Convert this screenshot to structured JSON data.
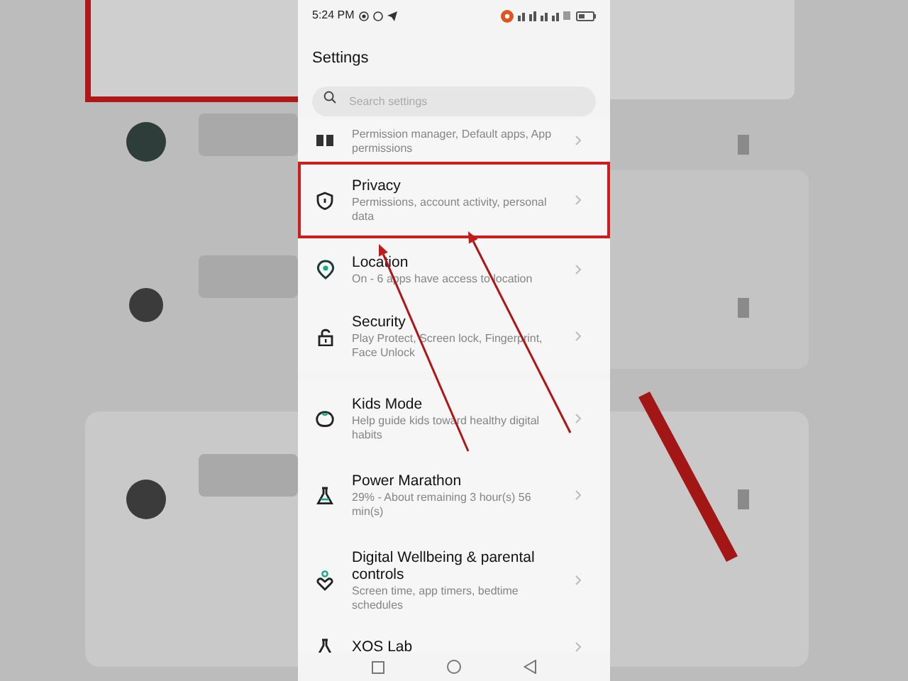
{
  "status_bar": {
    "time": "5:24 PM"
  },
  "title": "Settings",
  "search": {
    "placeholder": "Search settings"
  },
  "items": [
    {
      "kind": "apps",
      "subtitle": "Permission manager, Default apps, App permissions",
      "highlighted": false
    },
    {
      "kind": "privacy",
      "title": "Privacy",
      "subtitle": "Permissions, account activity, personal data",
      "highlighted": true
    },
    {
      "kind": "location",
      "title": "Location",
      "subtitle": "On - 6 apps have access to location",
      "highlighted": false
    },
    {
      "kind": "security",
      "title": "Security",
      "subtitle": "Play Protect, Screen lock, Fingerprint, Face Unlock",
      "highlighted": false
    },
    {
      "kind": "kids",
      "title": "Kids Mode",
      "subtitle": "Help guide kids toward healthy digital habits",
      "highlighted": false
    },
    {
      "kind": "power",
      "title": "Power Marathon",
      "subtitle": "29% - About remaining 3 hour(s)  56 min(s)",
      "highlighted": false
    },
    {
      "kind": "wellbeing",
      "title": "Digital Wellbeing & parental controls",
      "subtitle": "Screen time, app timers, bedtime schedules",
      "highlighted": false
    },
    {
      "kind": "lab",
      "title": "XOS Lab",
      "highlighted": false
    }
  ]
}
